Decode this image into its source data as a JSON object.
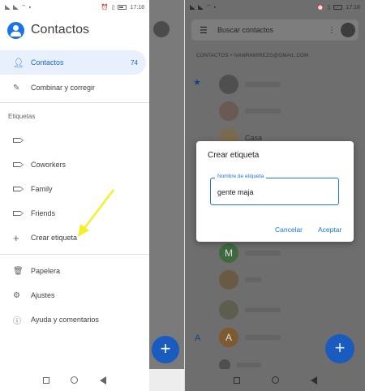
{
  "left": {
    "status": {
      "time": "17:18"
    },
    "app_title": "Contactos",
    "nav": {
      "contacts_label": "Contactos",
      "contacts_count": "74",
      "merge_label": "Combinar y corregir"
    },
    "labels_section": "Etiquetas",
    "labels": [
      "",
      "Coworkers",
      "Family",
      "Friends"
    ],
    "create_label": "Crear etiqueta",
    "trash_label": "Papelera",
    "settings_label": "Ajustes",
    "help_label": "Ayuda y comentarios",
    "arrow_color": "#f5ef2a"
  },
  "right": {
    "status": {
      "time": "17:18"
    },
    "search_placeholder": "Buscar contactos",
    "account_header": "CONTACTOS • IVANRAMIREZG@GMAIL.COM",
    "contact_names": [
      "Casa"
    ],
    "avatar_letters": [
      "M",
      "A"
    ],
    "section_letter": "A",
    "dialog": {
      "title": "Crear etiqueta",
      "field_label": "Nombre de etiqueta",
      "field_value": "gente maja",
      "cancel": "Cancelar",
      "accept": "Aceptar"
    }
  },
  "colors": {
    "accent": "#1a73e8",
    "selected_bg": "#e8f0fe",
    "fab": "#1a5bbf"
  }
}
